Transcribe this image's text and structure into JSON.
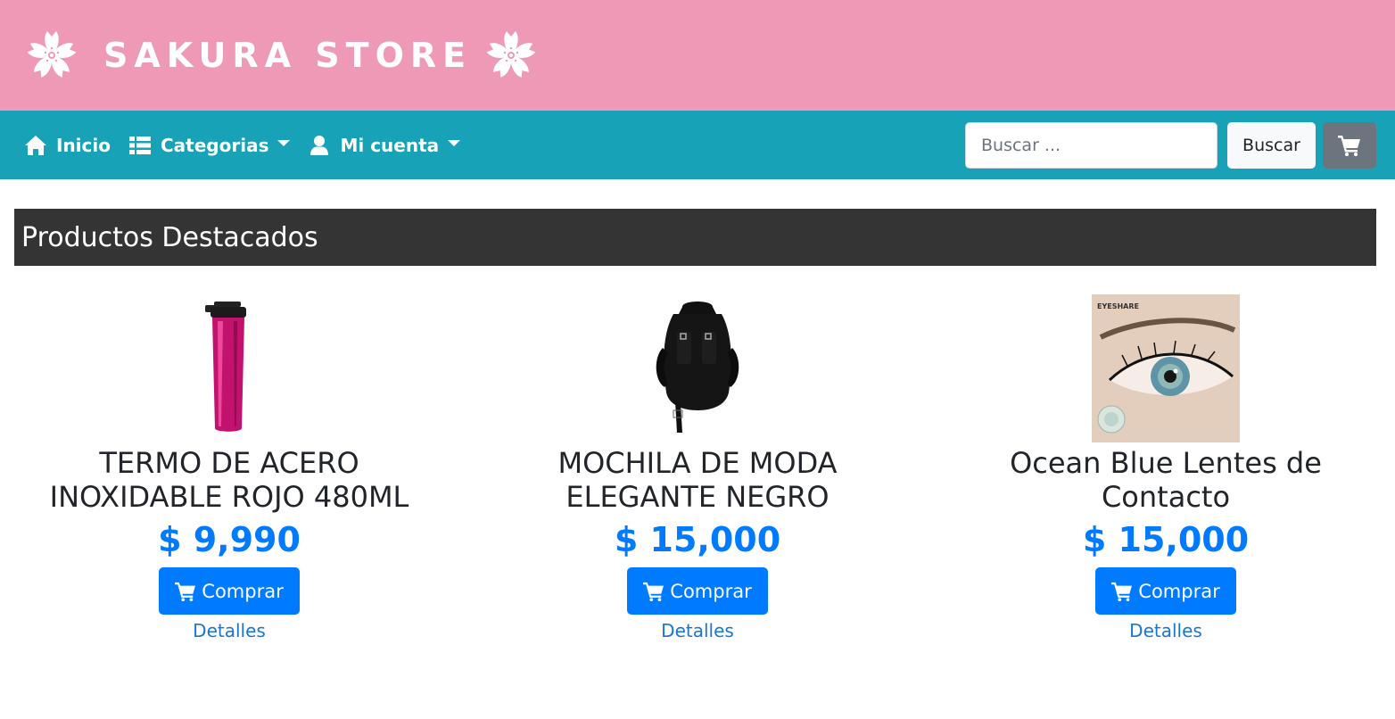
{
  "header": {
    "brand": "SAKURA STORE"
  },
  "nav": {
    "home_label": "Inicio",
    "categories_label": "Categorias",
    "account_label": "Mi cuenta"
  },
  "search": {
    "placeholder": "Buscar ...",
    "value": "",
    "button_label": "Buscar"
  },
  "section": {
    "title": "Productos Destacados"
  },
  "products": [
    {
      "name": "TERMO DE ACERO INOXIDABLE ROJO 480ML",
      "price": "$ 9,990",
      "buy_label": "Comprar",
      "details_label": "Detalles"
    },
    {
      "name": "MOCHILA DE MODA ELEGANTE NEGRO",
      "price": "$ 15,000",
      "buy_label": "Comprar",
      "details_label": "Detalles"
    },
    {
      "name": "Ocean Blue Lentes de Contacto",
      "price": "$ 15,000",
      "buy_label": "Comprar",
      "details_label": "Detalles",
      "image_text": "EYESHARE"
    }
  ],
  "icons": {
    "brand_left": "sakura-flower-icon",
    "brand_right": "sakura-flower-icon",
    "home": "home-icon",
    "categories": "th-list-icon",
    "account": "user-icon",
    "cart": "shopping-cart-icon"
  },
  "colors": {
    "banner": "#ee9ab7",
    "navbar": "#17a2b8",
    "section_header": "#343434",
    "price": "#007bff",
    "buy_button": "#007bff",
    "cart_button": "#6c757d"
  }
}
